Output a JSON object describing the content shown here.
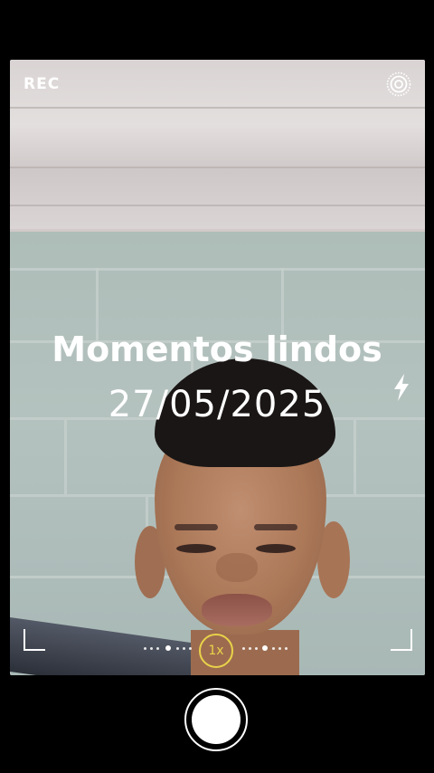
{
  "camera": {
    "rec_label": "REC",
    "overlay_title": "Momentos lindos",
    "overlay_date": "27/05/2025",
    "zoom_label": "1x",
    "icons": {
      "live": "live-photo-icon",
      "flash": "flash-icon"
    },
    "colors": {
      "zoom_accent": "#e8d24a",
      "ui_text": "#ffffff",
      "background": "#000000"
    }
  }
}
